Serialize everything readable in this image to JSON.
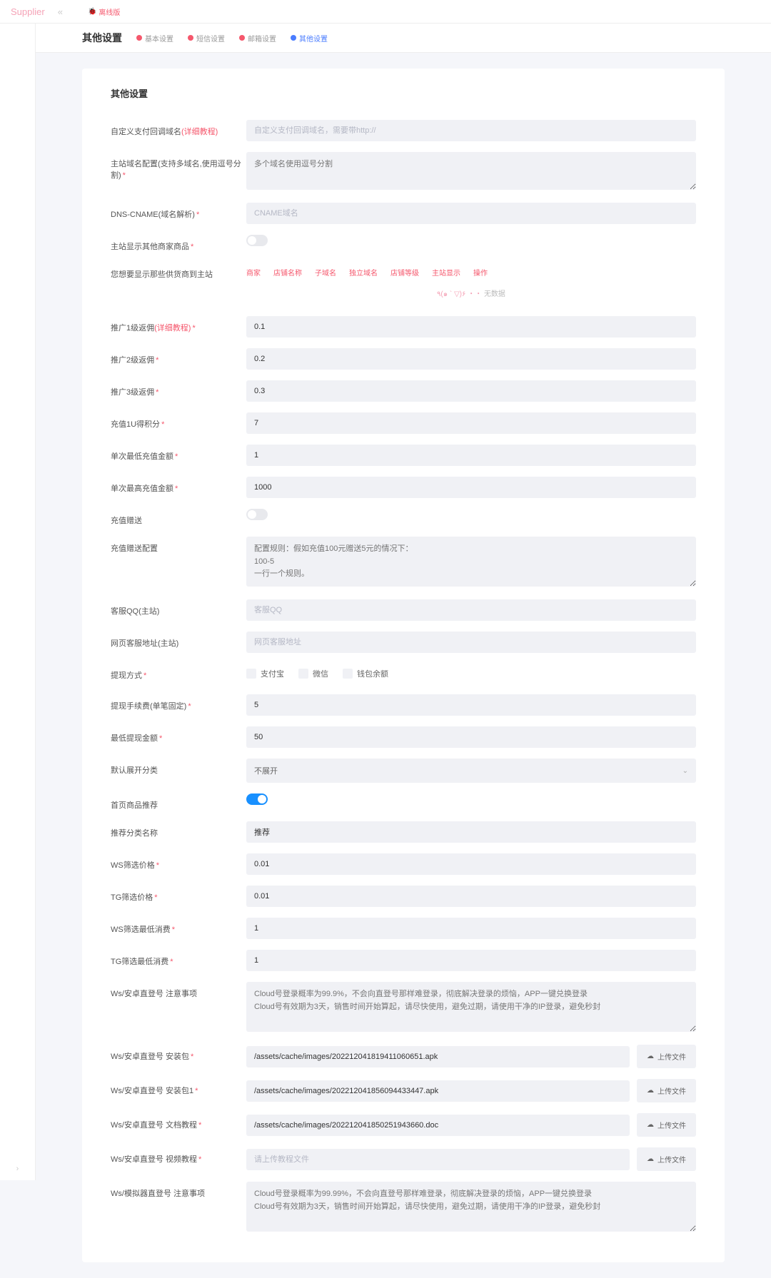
{
  "brand": "Supplier",
  "offline_label": "离线版",
  "page_title": "其他设置",
  "tabs": [
    {
      "label": "基本设置",
      "icon": "#f5576c"
    },
    {
      "label": "短信设置",
      "icon": "#f5576c"
    },
    {
      "label": "邮箱设置",
      "icon": "#f5576c"
    },
    {
      "label": "其他设置",
      "icon": "#4a7cff",
      "active": true
    }
  ],
  "section_title": "其他设置",
  "fields": {
    "custom_domain": {
      "label": "自定义支付回调域名",
      "link": "(详细教程)",
      "placeholder": "自定义支付回调域名，需要带http://"
    },
    "main_domain": {
      "label": "主站域名配置(支持多域名,使用逗号分割)",
      "required": true,
      "placeholder": "多个域名使用逗号分割"
    },
    "dns_cname": {
      "label": "DNS-CNAME(域名解析)",
      "required": true,
      "placeholder": "CNAME域名"
    },
    "show_other_merchants": {
      "label": "主站显示其他商家商品",
      "required": true,
      "value": false
    },
    "show_suppliers": {
      "label": "您想要显示那些供货商到主站"
    },
    "supplier_table": {
      "headers": [
        "商家",
        "店铺名称",
        "子域名",
        "独立域名",
        "店铺等级",
        "主站显示",
        "操作"
      ],
      "empty": "无数据",
      "emoji": "٩(๑ ` ▽)۶ ・・"
    },
    "promo1": {
      "label": "推广1级返佣",
      "link": "(详细教程)",
      "required": true,
      "value": "0.1"
    },
    "promo2": {
      "label": "推广2级返佣",
      "required": true,
      "value": "0.2"
    },
    "promo3": {
      "label": "推广3级返佣",
      "required": true,
      "value": "0.3"
    },
    "recharge_points": {
      "label": "充值1U得积分",
      "required": true,
      "value": "7"
    },
    "min_recharge": {
      "label": "单次最低充值金额",
      "required": true,
      "value": "1"
    },
    "max_recharge": {
      "label": "单次最高充值金额",
      "required": true,
      "value": "1000"
    },
    "recharge_gift": {
      "label": "充值赠送",
      "value": false
    },
    "recharge_gift_config": {
      "label": "充值赠送配置",
      "placeholder": "配置规则：假如充值100元赠送5元的情况下：\n100-5\n一行一个规则。"
    },
    "qq": {
      "label": "客服QQ(主站)",
      "placeholder": "客服QQ"
    },
    "web_service": {
      "label": "网页客服地址(主站)",
      "placeholder": "网页客服地址"
    },
    "withdraw_method": {
      "label": "提现方式",
      "required": true,
      "options": [
        "支付宝",
        "微信",
        "钱包余额"
      ]
    },
    "withdraw_fee": {
      "label": "提现手续费(单笔固定)",
      "required": true,
      "value": "5"
    },
    "min_withdraw": {
      "label": "最低提现金额",
      "required": true,
      "value": "50"
    },
    "default_expand": {
      "label": "默认展开分类",
      "value": "不展开"
    },
    "home_recommend": {
      "label": "首页商品推荐",
      "value": true
    },
    "recommend_name": {
      "label": "推荐分类名称",
      "value": "推荐"
    },
    "ws_filter_price": {
      "label": "WS筛选价格",
      "required": true,
      "value": "0.01"
    },
    "tg_filter_price": {
      "label": "TG筛选价格",
      "required": true,
      "value": "0.01"
    },
    "ws_min_spend": {
      "label": "WS筛选最低消费",
      "required": true,
      "value": "1"
    },
    "tg_min_spend": {
      "label": "TG筛选最低消费",
      "required": true,
      "value": "1"
    },
    "ws_android_notes": {
      "label": "Ws/安卓直登号 注意事项",
      "value": "Cloud号登录概率为99.9%，不会向直登号那样难登录，彻底解决登录的烦恼，APP一键兑换登录\nCloud号有效期为3天，销售时间开始算起，请尽快使用，避免过期，请使用干净的IP登录，避免秒封"
    },
    "ws_android_pkg": {
      "label": "Ws/安卓直登号 安装包",
      "required": true,
      "value": "/assets/cache/images/202212041819411060651.apk"
    },
    "ws_android_pkg1": {
      "label": "Ws/安卓直登号 安装包1",
      "required": true,
      "value": "/assets/cache/images/202212041856094433447.apk"
    },
    "ws_android_doc": {
      "label": "Ws/安卓直登号 文档教程",
      "required": true,
      "value": "/assets/cache/images/202212041850251943660.doc"
    },
    "ws_android_video": {
      "label": "Ws/安卓直登号 视频教程",
      "required": true,
      "placeholder": "请上传教程文件"
    },
    "ws_sim_notes": {
      "label": "Ws/模拟器直登号 注意事项",
      "value": "Cloud号登录概率为99.99%，不会向直登号那样难登录，彻底解决登录的烦恼，APP一键兑换登录\nCloud号有效期为3天，销售时间开始算起，请尽快使用，避免过期，请使用干净的IP登录，避免秒封"
    }
  },
  "upload_btn": "上传文件"
}
